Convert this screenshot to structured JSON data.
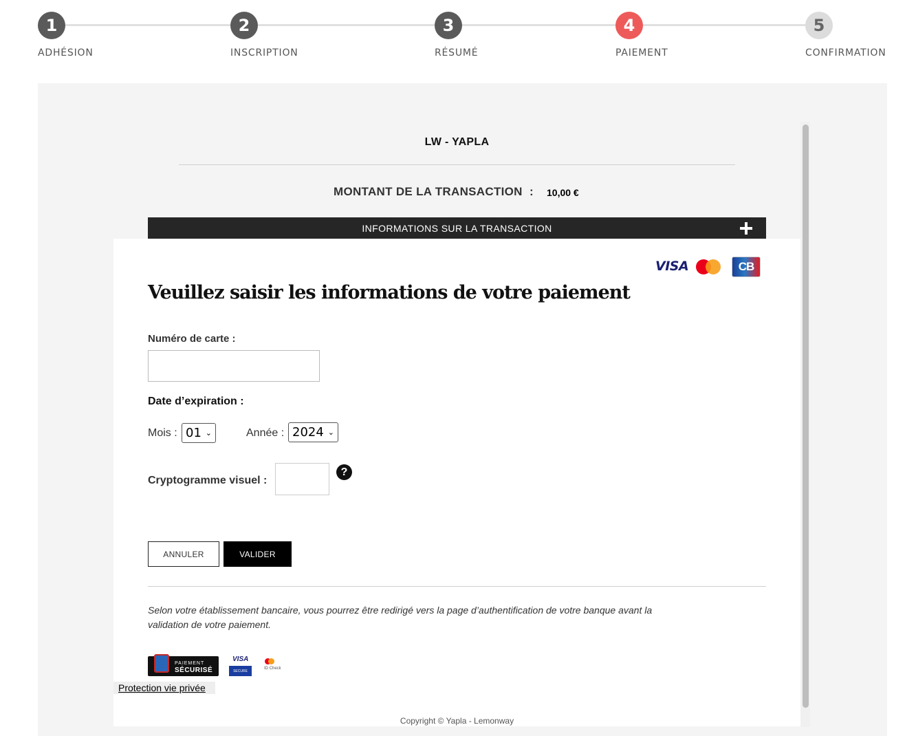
{
  "stepper": {
    "steps": [
      {
        "number": "1",
        "label": "ADHÉSION",
        "state": "done"
      },
      {
        "number": "2",
        "label": "INSCRIPTION",
        "state": "done"
      },
      {
        "number": "3",
        "label": "RÉSUMÉ",
        "state": "done"
      },
      {
        "number": "4",
        "label": "PAIEMENT",
        "state": "active"
      },
      {
        "number": "5",
        "label": "CONFIRMATION",
        "state": "todo"
      }
    ]
  },
  "colors": {
    "step_done": "#5a5a5a",
    "step_active": "#ee5a5a",
    "step_todo": "#dcdcdc",
    "info_bar": "#262626"
  },
  "merchant": {
    "name": "LW - YAPLA"
  },
  "transaction": {
    "amount_label": "MONTANT DE LA TRANSACTION",
    "amount_colon": ":",
    "amount_value": "10,00 €",
    "info_bar_label": "INFORMATIONS SUR LA TRANSACTION",
    "info_bar_icon": "plus-icon"
  },
  "card_logos": {
    "visa": "VISA",
    "cb": "CB"
  },
  "form": {
    "title": "Veuillez saisir les informations de votre paiement",
    "card_number_label": "Numéro de carte :",
    "card_number_value": "",
    "expiry_label": "Date d’expiration :",
    "month_label": "Mois :",
    "month_value": "01",
    "year_label": "Année :",
    "year_value": "2024",
    "cvv_label": "Cryptogramme visuel :",
    "cvv_value": "",
    "help_icon_glyph": "?",
    "cancel_label": "ANNULER",
    "submit_label": "VALIDER"
  },
  "notice": "Selon votre établissement bancaire, vous pourrez être redirigé vers la page d’authentification de votre banque avant la validation de votre paiement.",
  "badges": {
    "secure_line1": "PAIEMENT",
    "secure_line2": "SÉCURISÉ",
    "visa_secure_brand": "VISA",
    "visa_secure_sub": "SECURE",
    "mc_idcheck": "ID Check"
  },
  "footer": {
    "privacy_link": "Protection vie privée",
    "copyright": "Copyright © Yapla - Lemonway"
  }
}
